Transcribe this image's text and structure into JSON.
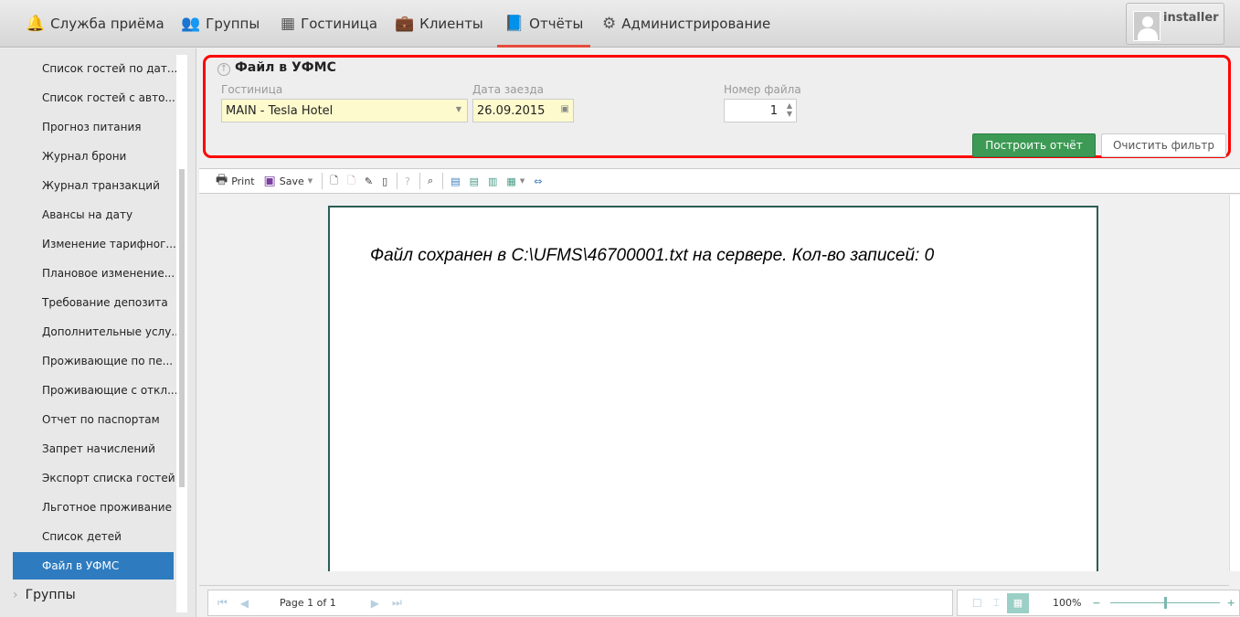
{
  "nav": {
    "items": [
      {
        "label": "Служба приёма",
        "icon": "bell-icon"
      },
      {
        "label": "Группы",
        "icon": "users-icon"
      },
      {
        "label": "Гостиница",
        "icon": "building-icon"
      },
      {
        "label": "Клиенты",
        "icon": "briefcase-icon"
      },
      {
        "label": "Отчёты",
        "icon": "book-icon",
        "active": true
      },
      {
        "label": "Администрирование",
        "icon": "gears-icon"
      }
    ],
    "user": "installer"
  },
  "sidebar": {
    "items": [
      "Список гостей по дат...",
      "Список гостей с авто...",
      "Прогноз питания",
      "Журнал брони",
      "Журнал транзакций",
      "Авансы на дату",
      "Изменение тарифног...",
      "Плановое изменение...",
      "Требование депозита",
      "Дополнительные услу...",
      "Проживающие по пе...",
      "Проживающие с откл...",
      "Отчет по паспортам",
      "Запрет начислений",
      "Экспорт списка гостей",
      "Льготное проживание",
      "Список детей",
      "Файл в УФМС"
    ],
    "active": "Файл в УФМС",
    "group": "Группы"
  },
  "filter": {
    "title": "Файл в УФМС",
    "hotel_label": "Гостиница",
    "hotel_value": "MAIN - Tesla Hotel",
    "date_label": "Дата заезда",
    "date_value": "26.09.2015",
    "file_label": "Номер файла",
    "file_value": "1",
    "build": "Построить отчёт",
    "clear": "Очистить фильтр"
  },
  "toolbar": {
    "print": "Print",
    "save": "Save"
  },
  "report": {
    "message": "Файл сохранен в C:\\UFMS\\46700001.txt на сервере. Кол-во записей: 0"
  },
  "pager": {
    "page": "Page 1 of 1",
    "zoom": "100%",
    "zoom_fraction": 0.5
  },
  "colors": {
    "accent": "#e74c3c",
    "active": "#2e7bbf",
    "build": "#3d9a55",
    "highlight": "#ff0000"
  }
}
